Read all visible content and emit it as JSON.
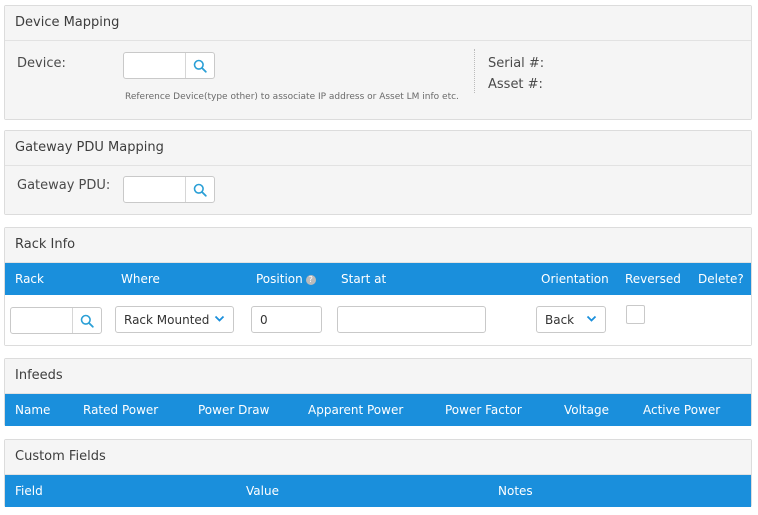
{
  "device_mapping": {
    "title": "Device Mapping",
    "device_label": "Device:",
    "device_value": "",
    "hint": "Reference Device(type other) to associate IP address or Asset LM info etc.",
    "serial_label": "Serial #:",
    "asset_label": "Asset #:"
  },
  "gateway_pdu_mapping": {
    "title": "Gateway PDU Mapping",
    "label": "Gateway PDU:",
    "value": ""
  },
  "rack_info": {
    "title": "Rack Info",
    "columns": [
      "Rack",
      "Where",
      "Position",
      "Start at",
      "Orientation",
      "Reversed",
      "Delete?"
    ],
    "help_glyph": "?",
    "row": {
      "rack": "",
      "where": "Rack Mounted",
      "position": "0",
      "start_at": "",
      "orientation": "Back",
      "reversed": false
    }
  },
  "infeeds": {
    "title": "Infeeds",
    "columns": [
      "Name",
      "Rated Power",
      "Power Draw",
      "Apparent Power",
      "Power Factor",
      "Voltage",
      "Active Power"
    ]
  },
  "custom_fields": {
    "title": "Custom Fields",
    "columns": [
      "Field",
      "Value",
      "Notes"
    ]
  },
  "colors": {
    "header_blue": "#1a8fdc",
    "panel_bg": "#f5f5f5",
    "search_icon": "#2a9fd6"
  },
  "icons": [
    "search-icon",
    "chevron-down-icon",
    "help-icon"
  ]
}
